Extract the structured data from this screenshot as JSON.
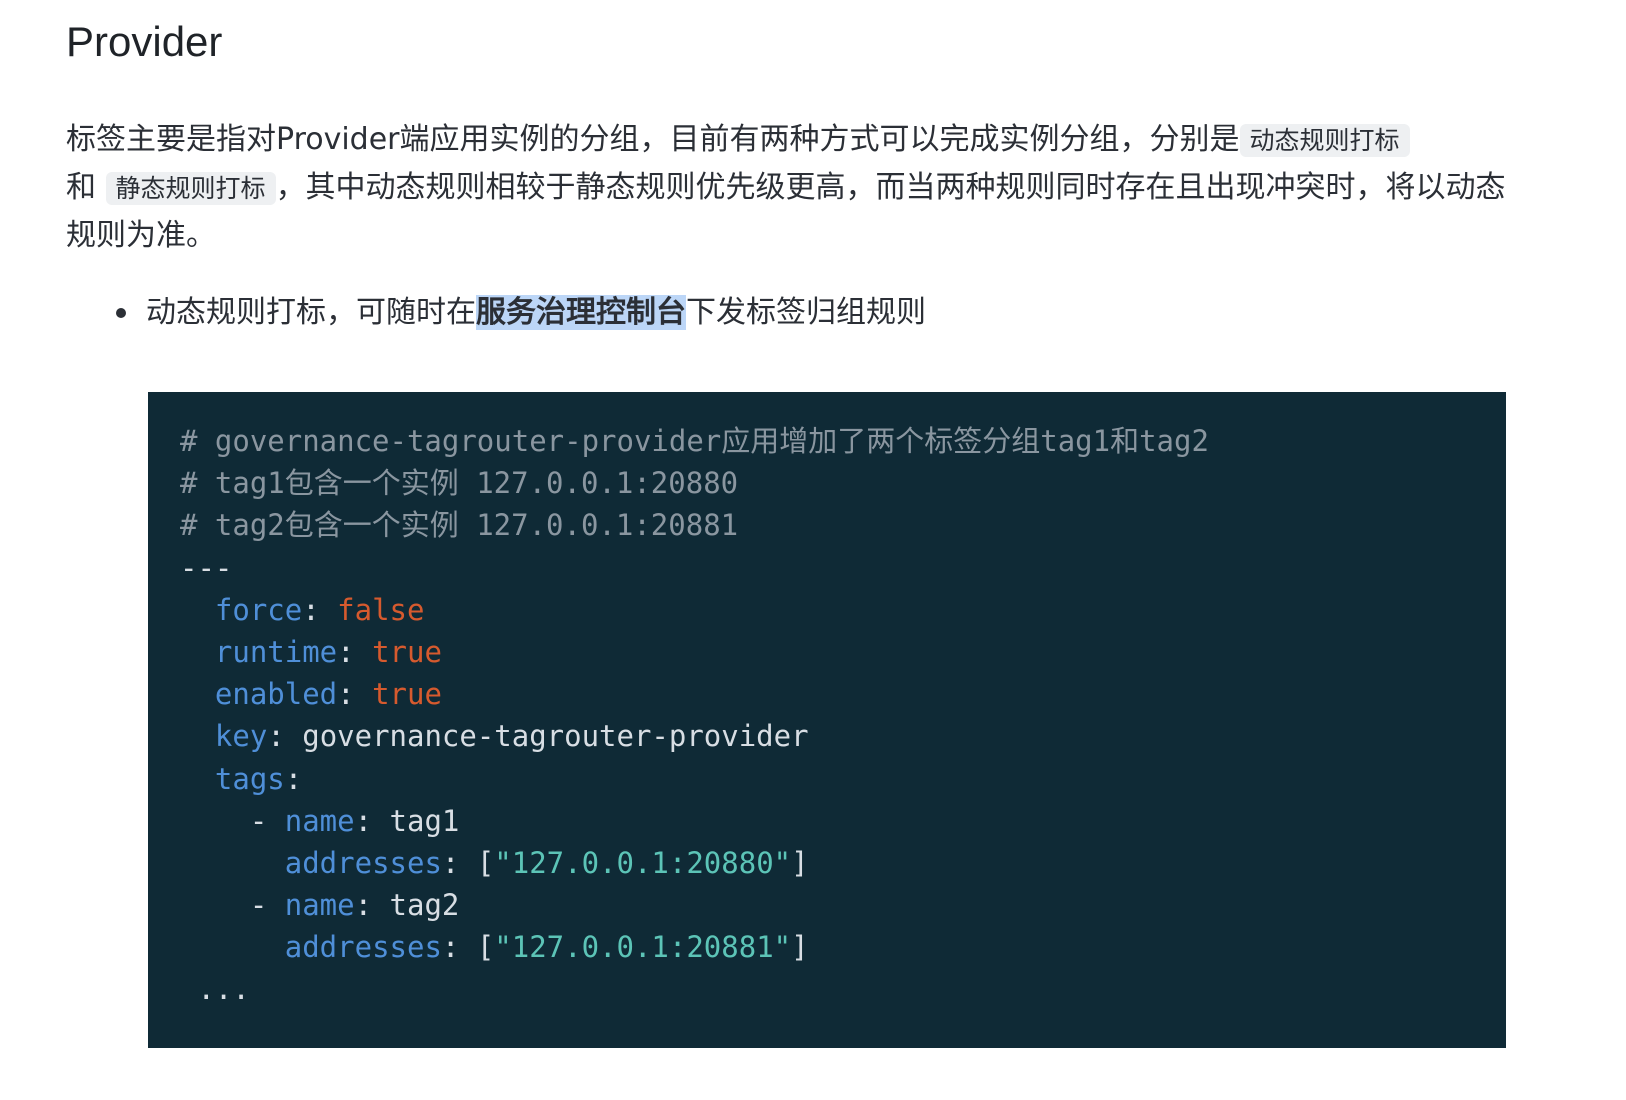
{
  "heading": "Provider",
  "paragraph": {
    "part1": "标签主要是指对Provider端应用实例的分组，目前有两种方式可以完成实例分组，分别是",
    "code1": "动态规则打标",
    "part2": "和",
    "code2": "静态规则打标",
    "part3": "，其中动态规则相较于静态规则优先级更高，而当两种规则同时存在且出现冲突时，将以动态规则为准。"
  },
  "list": {
    "item1_before": "动态规则打标，可随时在",
    "item1_highlight": "服务治理控制台",
    "item1_after": "下发标签归组规则"
  },
  "code": {
    "comment1": "# governance-tagrouter-provider应用增加了两个标签分组tag1和tag2",
    "comment2": "# tag1包含一个实例 127.0.0.1:20880",
    "comment3": "# tag2包含一个实例 127.0.0.1:20881",
    "separator": "---",
    "force_key": "force",
    "force_val": "false",
    "runtime_key": "runtime",
    "runtime_val": "true",
    "enabled_key": "enabled",
    "enabled_val": "true",
    "key_key": "key",
    "key_val": "governance-tagrouter-provider",
    "tags_key": "tags",
    "name_key": "name",
    "tag1": "tag1",
    "tag2": "tag2",
    "addresses_key": "addresses",
    "addr1": "\"127.0.0.1:20880\"",
    "addr2": "\"127.0.0.1:20881\"",
    "ellipsis": "..."
  },
  "colors": {
    "code_bg": "#0f2a36",
    "comment": "#8a96a0",
    "key": "#4f8fd8",
    "bool": "#d65a2e",
    "string": "#5cc4b7",
    "highlight": "#bcd6f7"
  }
}
